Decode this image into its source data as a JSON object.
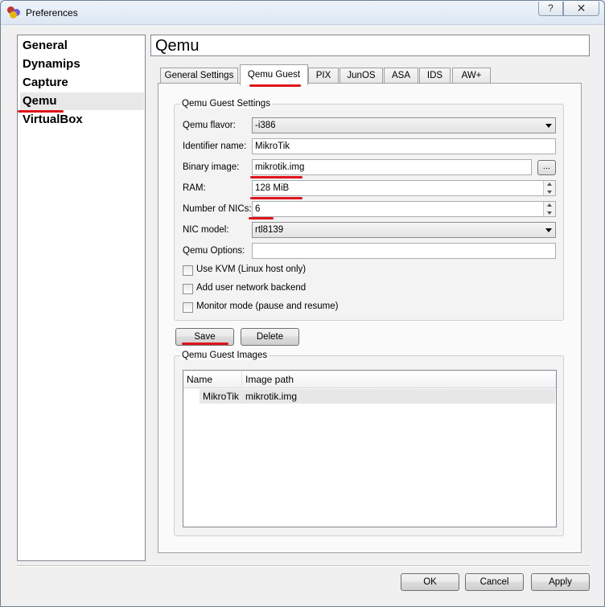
{
  "window": {
    "title": "Preferences",
    "help_label": "?",
    "close_label": "✕"
  },
  "sidebar": {
    "items": [
      {
        "label": "General"
      },
      {
        "label": "Dynamips"
      },
      {
        "label": "Capture"
      },
      {
        "label": "Qemu",
        "selected": true
      },
      {
        "label": "VirtualBox"
      }
    ]
  },
  "header": {
    "title": "Qemu"
  },
  "tabs": [
    {
      "label": "General Settings"
    },
    {
      "label": "Qemu Guest",
      "active": true
    },
    {
      "label": "PIX"
    },
    {
      "label": "JunOS"
    },
    {
      "label": "ASA"
    },
    {
      "label": "IDS"
    },
    {
      "label": "AW+"
    }
  ],
  "guest_settings": {
    "group_title": "Qemu Guest Settings",
    "flavor_label": "Qemu flavor:",
    "flavor_value": "-i386",
    "identifier_label": "Identifier name:",
    "identifier_value": "MikroTik",
    "binary_label": "Binary image:",
    "binary_value": "mikrotik.img",
    "browse_label": "...",
    "ram_label": "RAM:",
    "ram_value": "128 MiB",
    "nics_label": "Number of NICs:",
    "nics_value": "6",
    "nic_model_label": "NIC model:",
    "nic_model_value": "rtl8139",
    "options_label": "Qemu Options:",
    "options_value": "",
    "checkboxes": [
      {
        "label": "Use KVM (Linux host only)",
        "checked": false
      },
      {
        "label": "Add user network backend",
        "checked": false
      },
      {
        "label": "Monitor mode (pause and resume)",
        "checked": false
      }
    ]
  },
  "actions": {
    "save_label": "Save",
    "delete_label": "Delete"
  },
  "images": {
    "group_title": "Qemu Guest Images",
    "columns": [
      "Name",
      "Image path"
    ],
    "rows": [
      {
        "name": "MikroTik",
        "path": "mikrotik.img"
      }
    ]
  },
  "footer": {
    "ok_label": "OK",
    "cancel_label": "Cancel",
    "apply_label": "Apply"
  },
  "colors": {
    "annotation": "#e0141b",
    "selection": "#e8e8e8"
  }
}
